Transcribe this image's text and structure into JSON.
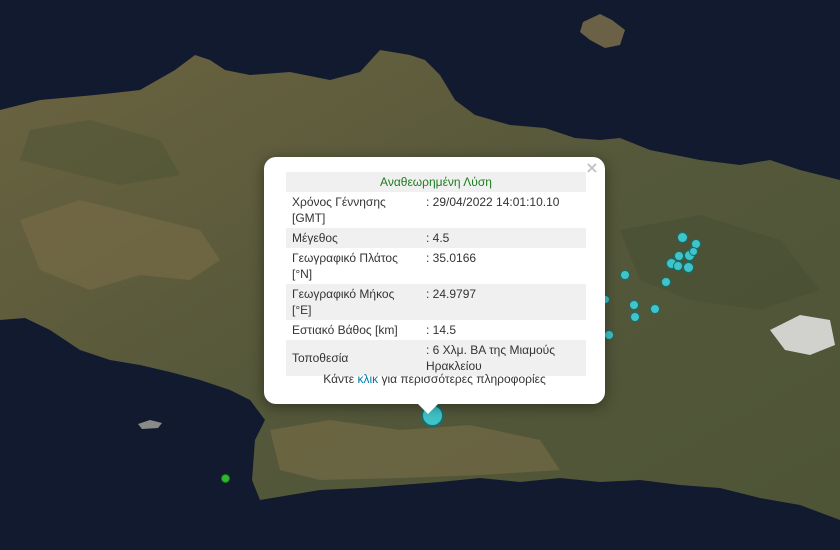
{
  "popup": {
    "title": "Αναθεωρημένη Λύση",
    "close_glyph": "×",
    "rows": [
      {
        "label": "Χρόνος Γέννησης [GMT]",
        "value": ": 29/04/2022 14:01:10.10"
      },
      {
        "label": "Μέγεθος",
        "value": ": 4.5"
      },
      {
        "label": "Γεωγραφικό Πλάτος [°N]",
        "value": ": 35.0166"
      },
      {
        "label": "Γεωγραφικό Μήκος [°E]",
        "value": ": 24.9797"
      },
      {
        "label": "Εστιακό Βάθος [km]",
        "value": ": 14.5"
      },
      {
        "label": "Τοποθεσία",
        "value": ": 6 Χλμ. ΒΑ της Μιαμούς Ηρακλείου"
      }
    ],
    "more_prefix": "Κάντε ",
    "more_link": "κλικ",
    "more_suffix": " για περισσότερες πληροφορίες"
  },
  "colors": {
    "sea": "#111a2e",
    "land": "#5a5a3a",
    "quake_marker": "#40c4c8",
    "quake_border": "#127074",
    "green_marker": "#2eb82e"
  }
}
